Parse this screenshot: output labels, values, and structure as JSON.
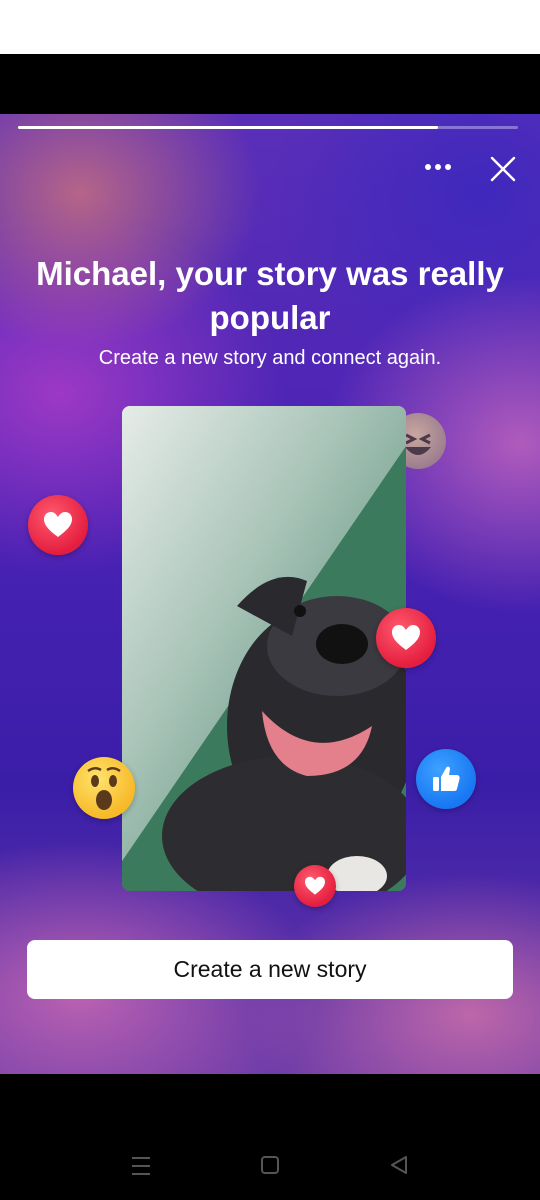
{
  "story": {
    "progress_fraction": 0.84,
    "headline": "Michael, your story was really popular",
    "subline": "Create a new story and connect again.",
    "cta_label": "Create a new story"
  },
  "toolbar": {
    "more_icon": "more-horizontal-icon",
    "close_icon": "close-icon"
  },
  "reactions": [
    "heart-reaction",
    "haha-reaction",
    "heart-reaction",
    "wow-reaction",
    "like-reaction",
    "heart-reaction"
  ],
  "navigation": {
    "recents_icon": "recents-icon",
    "home_icon": "home-icon",
    "back_icon": "back-icon"
  },
  "colors": {
    "heart": "#e41e3f",
    "like": "#1877f2",
    "button_bg": "#ffffff"
  }
}
